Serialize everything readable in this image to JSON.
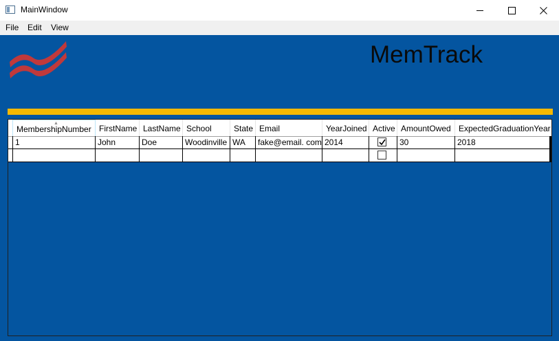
{
  "window": {
    "title": "MainWindow",
    "controls": [
      "minimize-icon",
      "maximize-icon",
      "close-icon"
    ]
  },
  "menu": {
    "items": [
      {
        "label": "File"
      },
      {
        "label": "Edit"
      },
      {
        "label": "View"
      }
    ]
  },
  "header": {
    "app_title": "MemTrack",
    "logo_icon": "flag-stripes-icon",
    "colors": {
      "background": "#0455a0",
      "logo": "#c0393b",
      "accent_bar": "#f5b800"
    }
  },
  "grid": {
    "sorted_column": "MembershipNumber",
    "columns": [
      {
        "label": "MembershipNumber"
      },
      {
        "label": "FirstName"
      },
      {
        "label": "LastName"
      },
      {
        "label": "School"
      },
      {
        "label": "State"
      },
      {
        "label": "Email"
      },
      {
        "label": "YearJoined"
      },
      {
        "label": "Active"
      },
      {
        "label": "AmountOwed"
      },
      {
        "label": "ExpectedGraduationYear"
      }
    ],
    "rows": [
      {
        "MembershipNumber": "1",
        "FirstName": "John",
        "LastName": "Doe",
        "School": "Woodinville",
        "State": "WA",
        "Email": "fake@email. com",
        "YearJoined": "2014",
        "Active": true,
        "AmountOwed": "30",
        "ExpectedGraduationYear": "2018"
      },
      {
        "MembershipNumber": "",
        "FirstName": "",
        "LastName": "",
        "School": "",
        "State": "",
        "Email": "",
        "YearJoined": "",
        "Active": false,
        "AmountOwed": "",
        "ExpectedGraduationYear": ""
      }
    ]
  }
}
